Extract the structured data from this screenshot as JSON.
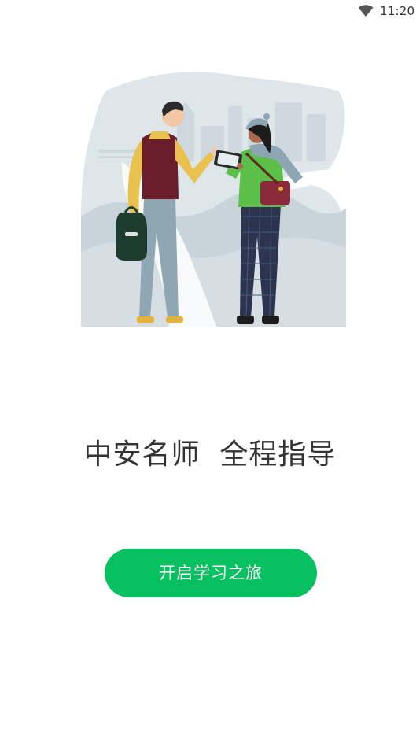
{
  "status_bar": {
    "time": "11:20",
    "wifi_icon": "wifi-icon"
  },
  "illustration": {
    "icon": "two-travelers-illustration"
  },
  "main": {
    "slogan": "中安名师  全程指导",
    "start_button_label": "开启学习之旅"
  },
  "colors": {
    "accent": "#07c160",
    "text": "#333333",
    "background": "#ffffff"
  }
}
